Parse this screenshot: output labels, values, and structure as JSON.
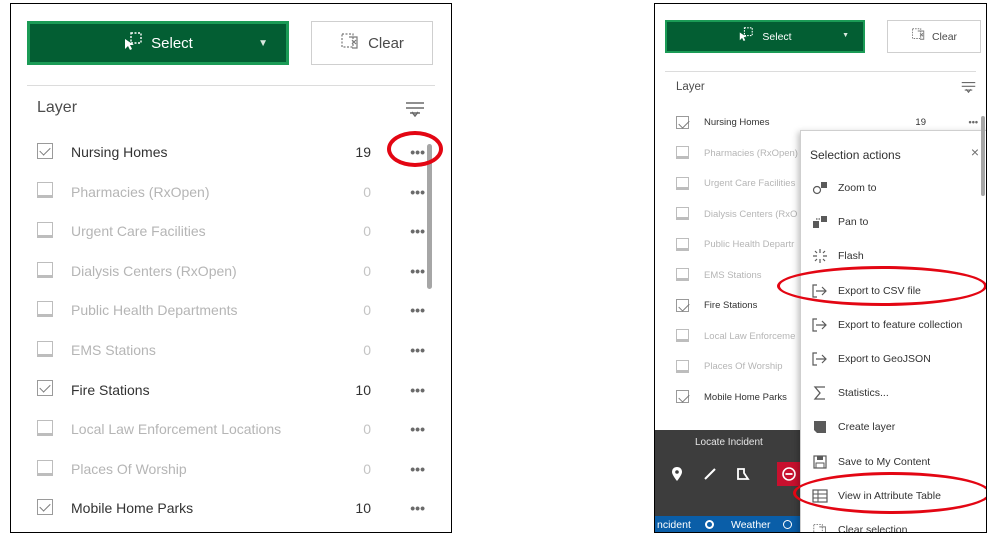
{
  "left": {
    "select_label": "Select",
    "clear_label": "Clear",
    "layer_header": "Layer",
    "layers": [
      {
        "name": "Nursing Homes",
        "count": "19",
        "checked": true
      },
      {
        "name": "Pharmacies (RxOpen)",
        "count": "0",
        "checked": false
      },
      {
        "name": "Urgent Care Facilities",
        "count": "0",
        "checked": false
      },
      {
        "name": "Dialysis Centers (RxOpen)",
        "count": "0",
        "checked": false
      },
      {
        "name": "Public Health Departments",
        "count": "0",
        "checked": false
      },
      {
        "name": "EMS Stations",
        "count": "0",
        "checked": false
      },
      {
        "name": "Fire Stations",
        "count": "10",
        "checked": true
      },
      {
        "name": "Local Law Enforcement Locations",
        "count": "0",
        "checked": false
      },
      {
        "name": "Places Of Worship",
        "count": "0",
        "checked": false
      },
      {
        "name": "Mobile Home Parks",
        "count": "10",
        "checked": true
      }
    ],
    "more_glyph": "•••"
  },
  "right": {
    "select_label": "Select",
    "clear_label": "Clear",
    "layer_header": "Layer",
    "layers": [
      {
        "name": "Nursing Homes",
        "count": "19",
        "checked": true
      },
      {
        "name": "Pharmacies (RxOpen)",
        "count": "",
        "checked": false
      },
      {
        "name": "Urgent Care Facilities",
        "count": "",
        "checked": false
      },
      {
        "name": "Dialysis Centers (RxO",
        "count": "",
        "checked": false
      },
      {
        "name": "Public Health Departr",
        "count": "",
        "checked": false
      },
      {
        "name": "EMS Stations",
        "count": "",
        "checked": false
      },
      {
        "name": "Fire Stations",
        "count": "",
        "checked": true
      },
      {
        "name": "Local Law Enforceme",
        "count": "",
        "checked": false
      },
      {
        "name": "Places Of Worship",
        "count": "",
        "checked": false
      },
      {
        "name": "Mobile Home Parks",
        "count": "",
        "checked": true
      }
    ],
    "menu": {
      "title": "Selection actions",
      "close": "×",
      "items": [
        {
          "label": "Zoom to",
          "icon": "zoom-to-icon"
        },
        {
          "label": "Pan to",
          "icon": "pan-to-icon"
        },
        {
          "label": "Flash",
          "icon": "flash-icon"
        },
        {
          "label": "Export to CSV file",
          "icon": "export-icon"
        },
        {
          "label": "Export to feature collection",
          "icon": "export-icon"
        },
        {
          "label": "Export to GeoJSON",
          "icon": "export-icon"
        },
        {
          "label": "Statistics...",
          "icon": "sigma-icon"
        },
        {
          "label": "Create layer",
          "icon": "layer-icon"
        },
        {
          "label": "Save to My Content",
          "icon": "save-icon"
        },
        {
          "label": "View in Attribute Table",
          "icon": "table-icon"
        },
        {
          "label": "Clear selection",
          "icon": "clear-icon"
        }
      ]
    },
    "locate_incident": "Locate Incident",
    "tabs": {
      "incident": "ncident",
      "weather": "Weather"
    }
  },
  "colors": {
    "accent": "#035e33",
    "highlight": "#e30613",
    "tab_blue": "#0a5ea8"
  }
}
